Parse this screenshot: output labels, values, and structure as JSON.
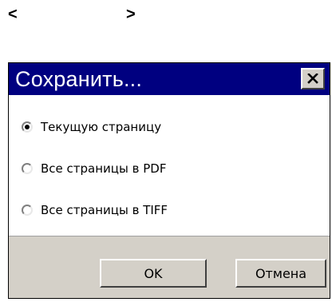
{
  "nav": {
    "prev_label": "<",
    "next_label": ">"
  },
  "dialog": {
    "title": "Сохранить...",
    "close_icon": "close-x-icon",
    "options": [
      {
        "label": "Текущую страницу",
        "checked": true
      },
      {
        "label": "Все страницы в PDF",
        "checked": false
      },
      {
        "label": "Все страницы в TIFF",
        "checked": false
      }
    ],
    "buttons": {
      "ok_label": "OK",
      "cancel_label": "Отмена"
    }
  },
  "colors": {
    "titlebar": "#000080",
    "title_text": "#ffffff",
    "button_face": "#d4d0c8"
  }
}
